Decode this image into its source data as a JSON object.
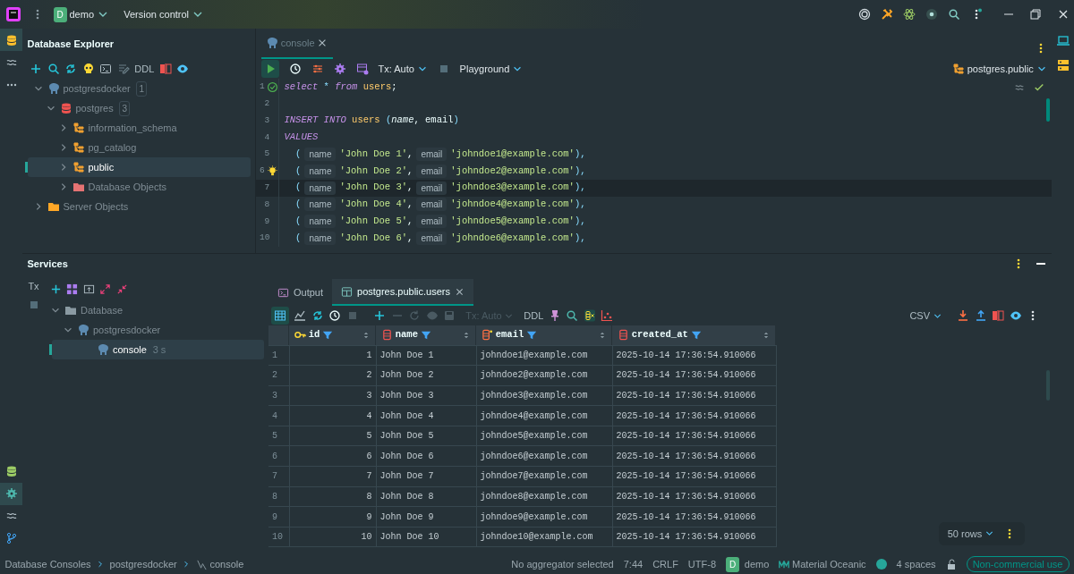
{
  "title_bar": {
    "project_badge": "D",
    "project": "demo",
    "vcs": "Version control"
  },
  "database_explorer": {
    "title": "Database Explorer",
    "toolbar_label": "DDL",
    "tree": [
      {
        "label": "postgresdocker",
        "kind": "datasource",
        "count": "1",
        "expanded": true,
        "selected": false,
        "children": [
          {
            "label": "postgres",
            "kind": "database",
            "count": "3",
            "expanded": true,
            "selected": false,
            "children": [
              {
                "label": "information_schema",
                "kind": "schema",
                "expanded": false,
                "selected": false
              },
              {
                "label": "pg_catalog",
                "kind": "schema",
                "expanded": false,
                "selected": false
              },
              {
                "label": "public",
                "kind": "schema",
                "expanded": false,
                "selected": true
              },
              {
                "label": "Database Objects",
                "kind": "objects",
                "expanded": false,
                "selected": false
              }
            ]
          }
        ]
      },
      {
        "label": "Server Objects",
        "kind": "server",
        "expanded": false,
        "selected": false
      }
    ]
  },
  "editor": {
    "tab": "console",
    "tx": "Tx: Auto",
    "mode": "Playground",
    "schema": "postgres.public",
    "lines": [
      {
        "number": "1",
        "executed": true,
        "intention": false,
        "current": false,
        "tokens": [
          {
            "text": "select",
            "kind": "keyword"
          },
          {
            "text": " * ",
            "kind": "operator"
          },
          {
            "text": "from",
            "kind": "keyword"
          },
          {
            "text": " users",
            "kind": "table"
          },
          {
            "text": ";",
            "kind": "plain"
          }
        ]
      },
      {
        "number": "2",
        "executed": false,
        "intention": false,
        "current": false
      },
      {
        "number": "3",
        "executed": false,
        "intention": false,
        "current": false,
        "tokens": [
          {
            "text": "INSERT INTO",
            "kind": "keyword"
          },
          {
            "text": " users ",
            "kind": "table"
          },
          {
            "text": "(",
            "kind": "punct"
          },
          {
            "text": "name",
            "kind": "param"
          },
          {
            "text": ", email",
            "kind": "plain"
          },
          {
            "text": ")",
            "kind": "punct"
          }
        ]
      },
      {
        "number": "4",
        "executed": false,
        "intention": false,
        "current": false,
        "tokens": [
          {
            "text": "VALUES",
            "kind": "keyword"
          }
        ]
      },
      {
        "number": "5",
        "executed": false,
        "intention": false,
        "current": false,
        "tokens": [
          {
            "text": "  (",
            "kind": "punct"
          },
          {
            "text": "name",
            "kind": "hint"
          },
          {
            "text": "'John Doe 1'",
            "kind": "string"
          },
          {
            "text": ",",
            "kind": "plain"
          },
          {
            "text": "email",
            "kind": "hint"
          },
          {
            "text": "'johndoe1@example.com'",
            "kind": "string"
          },
          {
            "text": "),",
            "kind": "punct"
          }
        ]
      },
      {
        "number": "6",
        "executed": false,
        "intention": true,
        "current": false,
        "tokens": [
          {
            "text": "  (",
            "kind": "punct"
          },
          {
            "text": "name",
            "kind": "hint"
          },
          {
            "text": "'John Doe 2'",
            "kind": "string"
          },
          {
            "text": ",",
            "kind": "plain"
          },
          {
            "text": "email",
            "kind": "hint"
          },
          {
            "text": "'johndoe2@example.com'",
            "kind": "string"
          },
          {
            "text": "),",
            "kind": "punct"
          }
        ]
      },
      {
        "number": "7",
        "executed": false,
        "intention": false,
        "current": true,
        "tokens": [
          {
            "text": "  (",
            "kind": "punct"
          },
          {
            "text": "name",
            "kind": "hint"
          },
          {
            "text": "'John Doe 3'",
            "kind": "string"
          },
          {
            "text": ",",
            "kind": "plain"
          },
          {
            "text": "email",
            "kind": "hint"
          },
          {
            "text": "'johndoe3@example.com'",
            "kind": "string"
          },
          {
            "text": "),",
            "kind": "punct"
          }
        ]
      },
      {
        "number": "8",
        "executed": false,
        "intention": false,
        "current": false,
        "tokens": [
          {
            "text": "  (",
            "kind": "punct"
          },
          {
            "text": "name",
            "kind": "hint"
          },
          {
            "text": "'John Doe 4'",
            "kind": "string"
          },
          {
            "text": ",",
            "kind": "plain"
          },
          {
            "text": "email",
            "kind": "hint"
          },
          {
            "text": "'johndoe4@example.com'",
            "kind": "string"
          },
          {
            "text": "),",
            "kind": "punct"
          }
        ]
      },
      {
        "number": "9",
        "executed": false,
        "intention": false,
        "current": false,
        "tokens": [
          {
            "text": "  (",
            "kind": "punct"
          },
          {
            "text": "name",
            "kind": "hint"
          },
          {
            "text": "'John Doe 5'",
            "kind": "string"
          },
          {
            "text": ",",
            "kind": "plain"
          },
          {
            "text": "email",
            "kind": "hint"
          },
          {
            "text": "'johndoe5@example.com'",
            "kind": "string"
          },
          {
            "text": "),",
            "kind": "punct"
          }
        ]
      },
      {
        "number": "10",
        "executed": false,
        "intention": false,
        "current": false,
        "tokens": [
          {
            "text": "  (",
            "kind": "punct"
          },
          {
            "text": "name",
            "kind": "hint"
          },
          {
            "text": "'John Doe 6'",
            "kind": "string"
          },
          {
            "text": ",",
            "kind": "plain"
          },
          {
            "text": "email",
            "kind": "hint"
          },
          {
            "text": "'johndoe6@example.com'",
            "kind": "string"
          },
          {
            "text": "),",
            "kind": "punct"
          }
        ]
      }
    ]
  },
  "services": {
    "title": "Services",
    "tx_label": "Tx",
    "tree": [
      {
        "label": "Database",
        "kind": "folder",
        "expanded": true,
        "selected": false,
        "children": [
          {
            "label": "postgresdocker",
            "kind": "datasource",
            "expanded": true,
            "selected": false,
            "children": [
              {
                "label": "console",
                "kind": "console",
                "note": "3 s",
                "selected": true
              }
            ]
          }
        ]
      }
    ],
    "tabs": [
      {
        "label": "Output",
        "kind": "output",
        "selected": false
      },
      {
        "label": "postgres.public.users",
        "kind": "table",
        "selected": true
      }
    ],
    "grid_toolbar": {
      "tx": "Tx: Auto",
      "ddl": "DDL",
      "format": "CSV"
    },
    "table": {
      "columns": [
        {
          "name": "id",
          "kind": "key"
        },
        {
          "name": "name",
          "kind": "column"
        },
        {
          "name": "email",
          "kind": "indexed"
        },
        {
          "name": "created_at",
          "kind": "column"
        }
      ],
      "rows": [
        {
          "number": "1",
          "cells": [
            "1",
            "John Doe 1",
            "johndoe1@example.com",
            "2025-10-14 17:36:54.910066"
          ]
        },
        {
          "number": "2",
          "cells": [
            "2",
            "John Doe 2",
            "johndoe2@example.com",
            "2025-10-14 17:36:54.910066"
          ]
        },
        {
          "number": "3",
          "cells": [
            "3",
            "John Doe 3",
            "johndoe3@example.com",
            "2025-10-14 17:36:54.910066"
          ]
        },
        {
          "number": "4",
          "cells": [
            "4",
            "John Doe 4",
            "johndoe4@example.com",
            "2025-10-14 17:36:54.910066"
          ]
        },
        {
          "number": "5",
          "cells": [
            "5",
            "John Doe 5",
            "johndoe5@example.com",
            "2025-10-14 17:36:54.910066"
          ]
        },
        {
          "number": "6",
          "cells": [
            "6",
            "John Doe 6",
            "johndoe6@example.com",
            "2025-10-14 17:36:54.910066"
          ]
        },
        {
          "number": "7",
          "cells": [
            "7",
            "John Doe 7",
            "johndoe7@example.com",
            "2025-10-14 17:36:54.910066"
          ]
        },
        {
          "number": "8",
          "cells": [
            "8",
            "John Doe 8",
            "johndoe8@example.com",
            "2025-10-14 17:36:54.910066"
          ]
        },
        {
          "number": "9",
          "cells": [
            "9",
            "John Doe 9",
            "johndoe9@example.com",
            "2025-10-14 17:36:54.910066"
          ]
        },
        {
          "number": "10",
          "cells": [
            "10",
            "John Doe 10",
            "johndoe10@example.com",
            "2025-10-14 17:36:54.910066"
          ]
        }
      ]
    },
    "page_size": "50 rows"
  },
  "status_bar": {
    "breadcrumbs": [
      {
        "label": "Database Consoles",
        "kind": "text"
      },
      {
        "label": "postgresdocker",
        "kind": "text"
      },
      {
        "label": "console",
        "kind": "console"
      }
    ],
    "aggregator": "No aggregator selected",
    "position": "7:44",
    "line_separator": "CRLF",
    "encoding": "UTF-8",
    "project_badge": "D",
    "project": "demo",
    "theme": "Material Oceanic",
    "indent": "4 spaces",
    "license": "Non-commercial use"
  }
}
